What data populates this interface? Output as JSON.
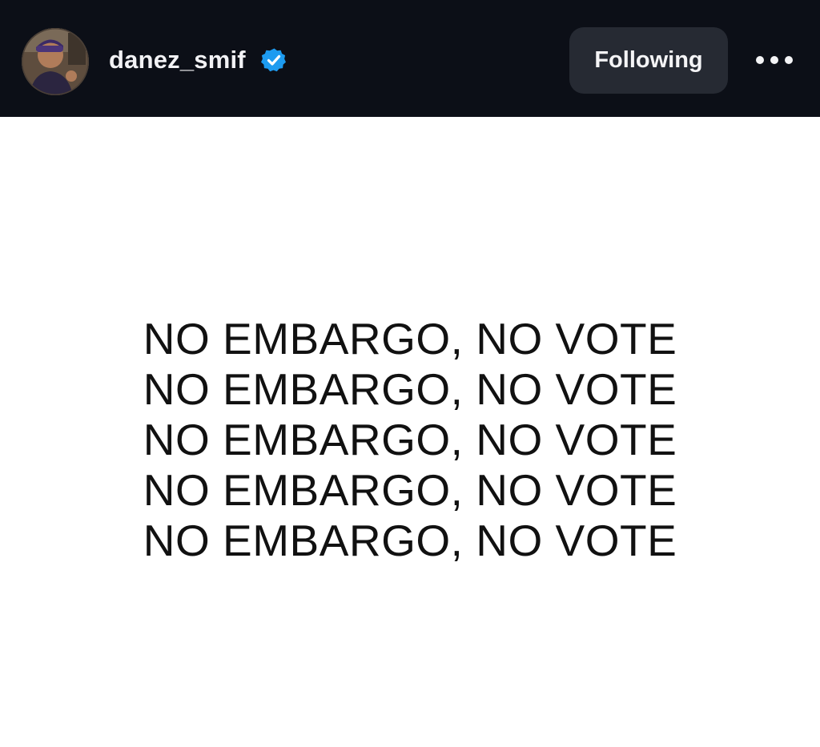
{
  "header": {
    "username": "danez_smif",
    "verified": true,
    "follow_button_label": "Following",
    "avatar_icon": "user-avatar",
    "verified_icon": "verified-badge-icon",
    "more_icon": "more-options-icon"
  },
  "post": {
    "lines": [
      "NO EMBARGO, NO VOTE",
      "NO EMBARGO, NO VOTE",
      "NO EMBARGO, NO VOTE",
      "NO EMBARGO, NO VOTE",
      "NO EMBARGO, NO VOTE"
    ]
  },
  "colors": {
    "header_bg": "#0c0f17",
    "button_bg": "#262a33",
    "verified_blue": "#1d9bf0",
    "post_bg": "#ffffff",
    "post_text": "#111111"
  }
}
